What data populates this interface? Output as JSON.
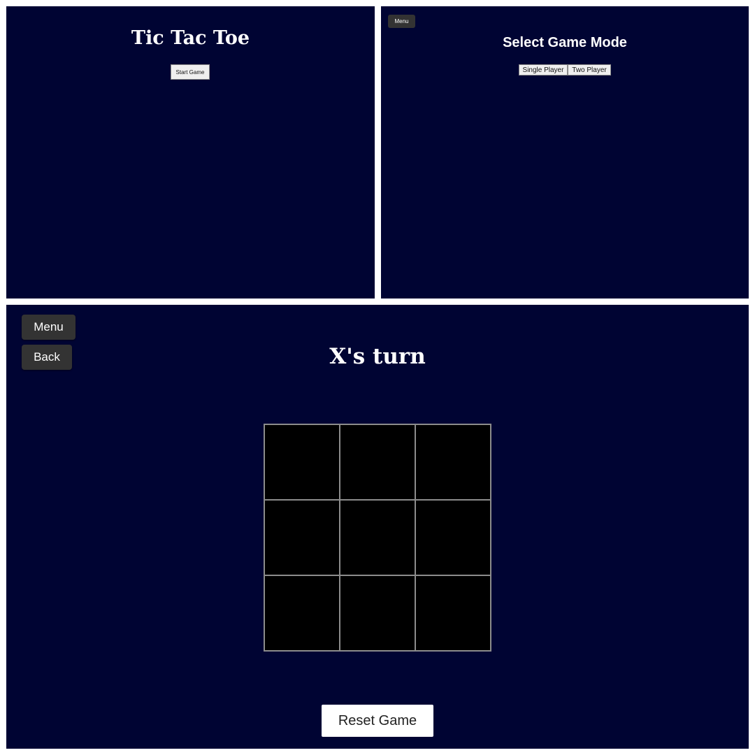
{
  "title_screen": {
    "heading": "Tic Tac Toe",
    "start_label": "Start Game"
  },
  "mode_screen": {
    "menu_label": "Menu",
    "heading": "Select Game Mode",
    "modes": [
      {
        "label": "Single Player"
      },
      {
        "label": "Two Player"
      }
    ]
  },
  "game_screen": {
    "menu_label": "Menu",
    "back_label": "Back",
    "turn_text": "X's turn",
    "board": [
      "",
      "",
      "",
      "",
      "",
      "",
      "",
      "",
      ""
    ],
    "reset_label": "Reset Game"
  },
  "colors": {
    "background": "#000433",
    "board_cell": "#000000",
    "grid_line": "#8c8c8c",
    "dark_button": "#333333"
  }
}
